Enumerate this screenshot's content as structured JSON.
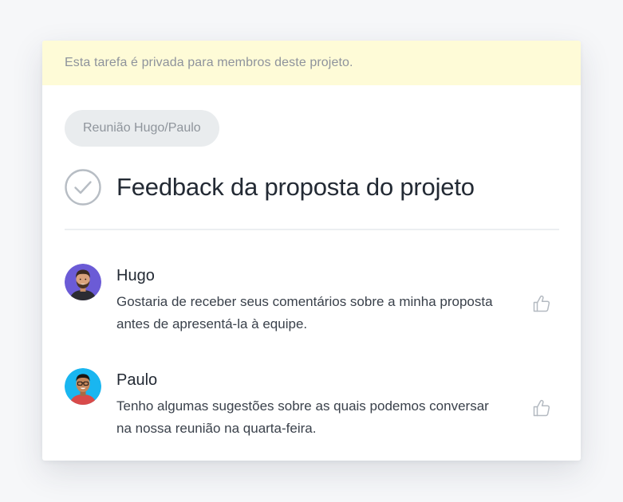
{
  "privacy_notice": "Esta tarefa é privada para membros deste projeto.",
  "tag": "Reunião Hugo/Paulo",
  "task": {
    "title": "Feedback da proposta do projeto",
    "completion_icon": "check-circle-icon"
  },
  "comments": [
    {
      "author": "Hugo",
      "text": "Gostaria de receber seus comentários sobre a minha proposta antes de apresentá-la à equipe.",
      "avatar_bg": "#6b5bd6",
      "like_icon": "thumbs-up-icon"
    },
    {
      "author": "Paulo",
      "text": "Tenho algumas sugestões sobre as quais podemos conversar na nossa reunião na quarta-feira.",
      "avatar_bg": "#19b6f0",
      "like_icon": "thumbs-up-icon"
    }
  ],
  "colors": {
    "banner_bg": "#fefbd7",
    "tag_bg": "#e9ecee",
    "text_dark": "#232a34",
    "icon_gray": "#b4bac1"
  }
}
